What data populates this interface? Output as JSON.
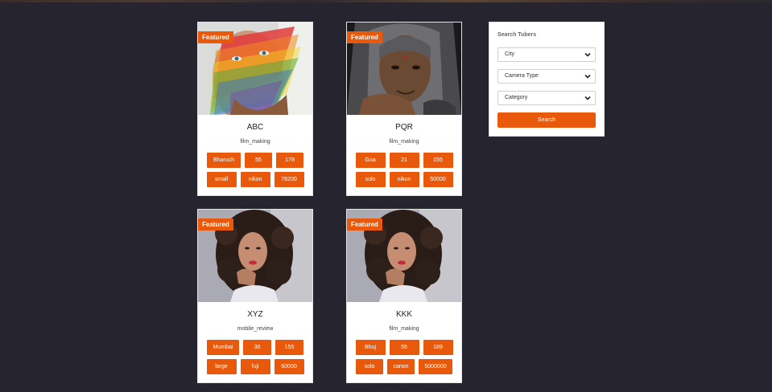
{
  "cards": [
    {
      "badge": "Featured",
      "name": "ABC",
      "category": "film_making",
      "row1": [
        "Bharuch",
        "55",
        "178"
      ],
      "row2": [
        "small",
        "nikon",
        "78200"
      ],
      "photo": "rainbow-face-man"
    },
    {
      "badge": "Featured",
      "name": "PQR",
      "category": "film_making",
      "row1": [
        "Goa",
        "21",
        "155"
      ],
      "row2": [
        "solo",
        "nikon",
        "50000"
      ],
      "photo": "elderly-woman-hooded"
    },
    {
      "badge": "Featured",
      "name": "XYZ",
      "category": "mobile_review",
      "row1": [
        "Mumbai",
        "30",
        "155"
      ],
      "row2": [
        "large",
        "fuji",
        "60000"
      ],
      "photo": "curly-hair-woman"
    },
    {
      "badge": "Featured",
      "name": "KKK",
      "category": "film_making",
      "row1": [
        "Bhuj",
        "55",
        "189"
      ],
      "row2": [
        "solo",
        "canon",
        "5000000"
      ],
      "photo": "curly-hair-woman"
    }
  ],
  "search": {
    "title": "Search Tubers",
    "city": "City",
    "camera_type": "Camera Type",
    "category": "Category",
    "button": "Search"
  },
  "colors": {
    "accent": "#e8590c",
    "background": "#25242f"
  }
}
